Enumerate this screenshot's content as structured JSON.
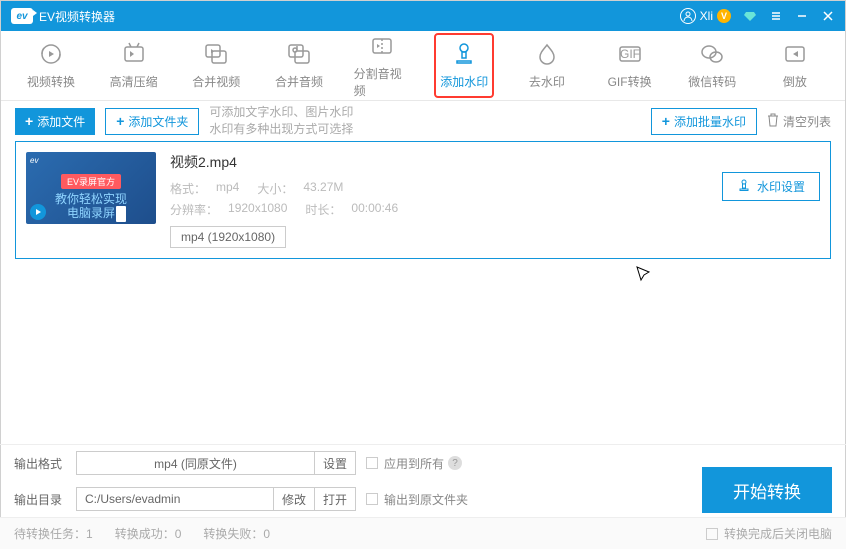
{
  "titlebar": {
    "app_name": "EV视频转换器",
    "user_name": "Xli"
  },
  "toolbar": {
    "items": [
      {
        "label": "视频转换"
      },
      {
        "label": "高清压缩"
      },
      {
        "label": "合并视频"
      },
      {
        "label": "合并音频"
      },
      {
        "label": "分割音视频"
      },
      {
        "label": "添加水印"
      },
      {
        "label": "去水印"
      },
      {
        "label": "GIF转换"
      },
      {
        "label": "微信转码"
      },
      {
        "label": "倒放"
      }
    ]
  },
  "actions": {
    "add_file": "添加文件",
    "add_folder": "添加文件夹",
    "hint_line1": "可添加文字水印、图片水印",
    "hint_line2": "水印有多种出现方式可选择",
    "batch": "添加批量水印",
    "clear": "清空列表"
  },
  "file": {
    "name": "视频2.mp4",
    "fmt_label": "格式：",
    "fmt_val": "mp4",
    "size_label": "大小：",
    "size_val": "43.27M",
    "res_label": "分辨率：",
    "res_val": "1920x1080",
    "dur_label": "时长：",
    "dur_val": "00:00:46",
    "select_fmt": "mp4 (1920x1080)",
    "wm_settings": "水印设置",
    "thumb_badge": "EV录屏官方",
    "thumb_sub1": "教你轻松实现",
    "thumb_sub2": "电脑录屏"
  },
  "output": {
    "fmt_label": "输出格式",
    "fmt_value": "mp4 (同原文件)",
    "settings": "设置",
    "dir_label": "输出目录",
    "dir_value": "C:/Users/evadmin",
    "modify": "修改",
    "open": "打开",
    "apply_all": "应用到所有",
    "output_orig": "输出到原文件夹",
    "start": "开始转换"
  },
  "status": {
    "pending_l": "待转换任务：",
    "pending_v": "1",
    "success_l": "转换成功：",
    "success_v": "0",
    "failed_l": "转换失败：",
    "failed_v": "0",
    "shutdown": "转换完成后关闭电脑"
  }
}
